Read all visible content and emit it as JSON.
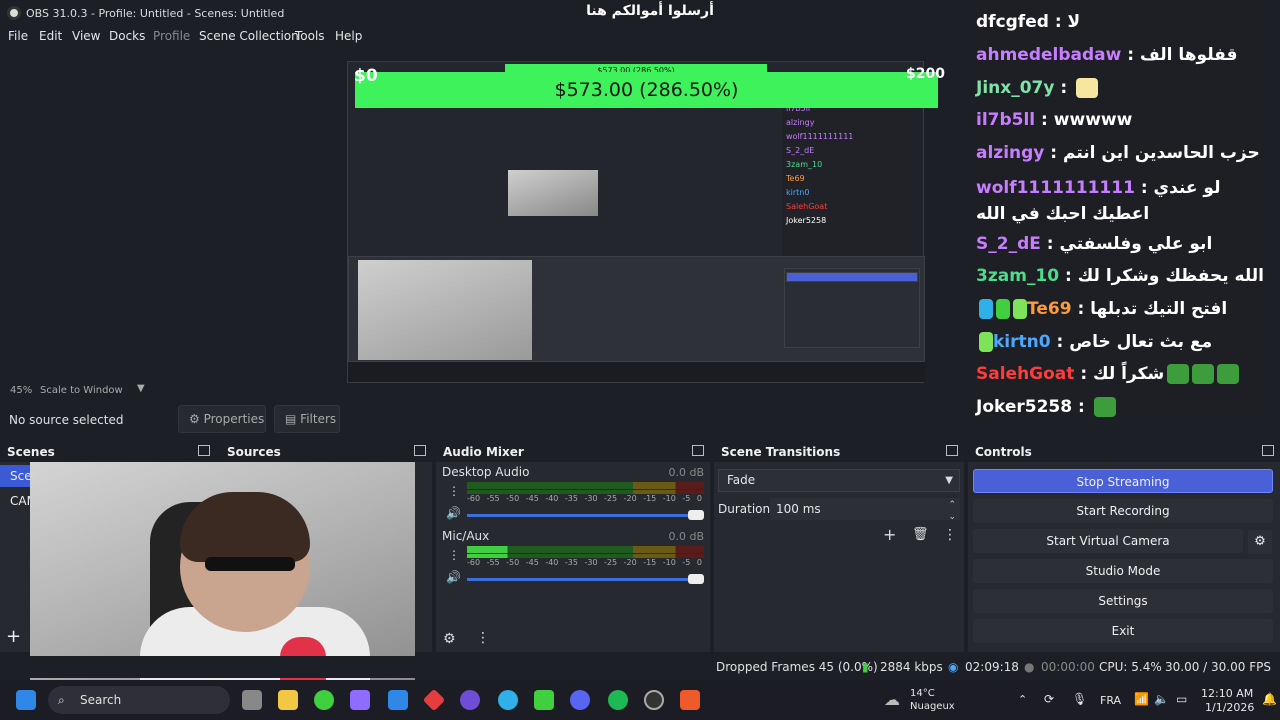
{
  "window": {
    "title": "OBS 31.0.3 - Profile: Untitled - Scenes: Untitled",
    "controls": [
      "—",
      "☐",
      "✕"
    ]
  },
  "menu": [
    "File",
    "Edit",
    "View",
    "Docks",
    "Profile",
    "Scene Collection",
    "Tools",
    "Help"
  ],
  "donation": {
    "title": "أرسلوا أموالكم هنا",
    "amount": "$573.00 (286.50%)",
    "min_label": "$0",
    "max_label": "$200",
    "progress_percent": 286.5
  },
  "chat": [
    {
      "user": "dfcgfed",
      "color": "#ffffff",
      "msg": "لا"
    },
    {
      "user": "ahmedelbadaw",
      "color": "#c77dff",
      "msg": "قفلوها الف"
    },
    {
      "user": "Jinx_07y",
      "color": "#7fe3a8",
      "msg": ""
    },
    {
      "user": "il7b5ll",
      "color": "#c77dff",
      "msg": "wwwww"
    },
    {
      "user": "alzingy",
      "color": "#c77dff",
      "msg": "حزب الحاسدين اين انتم"
    },
    {
      "user": "wolf1111111111",
      "color": "#c77dff",
      "msg": "لو عندي اعطيك احبك في الله"
    },
    {
      "user": "S_2_dE",
      "color": "#c77dff",
      "msg": "ابو علي وفلسفتي"
    },
    {
      "user": "3zam_10",
      "color": "#4ddc8a",
      "msg": "الله يحفظك وشكرا لك"
    },
    {
      "user": "Te69",
      "color": "#ff9a3c",
      "msg": "افتح التيك تدبلها"
    },
    {
      "user": "kirtn0",
      "color": "#4aa8ff",
      "msg": "مع بث تعال خاص"
    },
    {
      "user": "SalehGoat",
      "color": "#ff3c3c",
      "msg": "شكراً لك"
    },
    {
      "user": "Joker5258",
      "color": "#ffffff",
      "msg": ""
    }
  ],
  "preview_bar": {
    "zoom": "45%",
    "scale_mode": "Scale to Window"
  },
  "source_bar": {
    "no_source": "No source selected",
    "properties": "Properties",
    "filters": "Filters"
  },
  "docks": {
    "scenes": {
      "title": "Scenes",
      "items": [
        "Sce",
        "CAM"
      ]
    },
    "sources": {
      "title": "Sources"
    },
    "audio": {
      "title": "Audio Mixer",
      "scale": [
        "-60",
        "-55",
        "-50",
        "-45",
        "-40",
        "-35",
        "-30",
        "-25",
        "-20",
        "-15",
        "-10",
        "-5",
        "0"
      ],
      "channels": [
        {
          "name": "Desktop Audio",
          "db": "0.0 dB",
          "level": 0.0
        },
        {
          "name": "Mic/Aux",
          "db": "0.0 dB",
          "level": 0.17
        }
      ]
    },
    "transitions": {
      "title": "Scene Transitions",
      "selected": "Fade",
      "duration_label": "Duration",
      "duration_value": "100 ms"
    },
    "controls": {
      "title": "Controls",
      "buttons": [
        "Stop Streaming",
        "Start Recording",
        "Start Virtual Camera",
        "Studio Mode",
        "Settings",
        "Exit"
      ]
    }
  },
  "status": {
    "dropped": "Dropped Frames 45 (0.0%)",
    "bitrate": "2884 kbps",
    "stream_time": "02:09:18",
    "rec_time": "00:00:00",
    "cpu": "CPU: 5.4%",
    "fps": "30.00 / 30.00 FPS"
  },
  "taskbar": {
    "search": "Search",
    "weather_temp": "14°C",
    "weather_desc": "Nuageux",
    "lang": "FRA",
    "time": "12:10 AM",
    "date": "1/1/2026"
  },
  "colors": {
    "accent": "#4a60d6",
    "progress_bar": "#3df25a",
    "background": "#1d1f26"
  }
}
